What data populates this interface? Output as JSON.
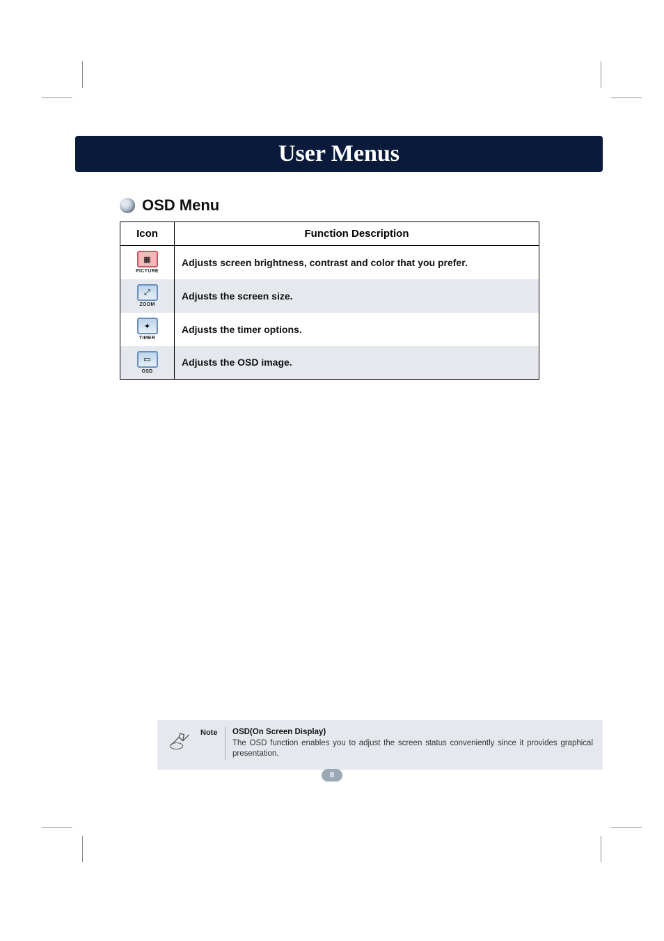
{
  "header": {
    "title": "User Menus"
  },
  "section": {
    "title": "OSD Menu"
  },
  "table": {
    "headers": {
      "icon": "Icon",
      "desc": "Function Description"
    },
    "rows": [
      {
        "icon_label": "PICTURE",
        "desc": "Adjusts screen brightness, contrast and color  that you prefer."
      },
      {
        "icon_label": "ZOOM",
        "desc": "Adjusts the screen size."
      },
      {
        "icon_label": "TIMER",
        "desc": "Adjusts the timer options."
      },
      {
        "icon_label": "OSD",
        "desc": "Adjusts the OSD image."
      }
    ]
  },
  "note": {
    "label": "Note",
    "title": "OSD(On Screen Display)",
    "body": "The OSD function enables you to adjust the screen status conveniently since it provides graphical presentation."
  },
  "page_number": "8"
}
